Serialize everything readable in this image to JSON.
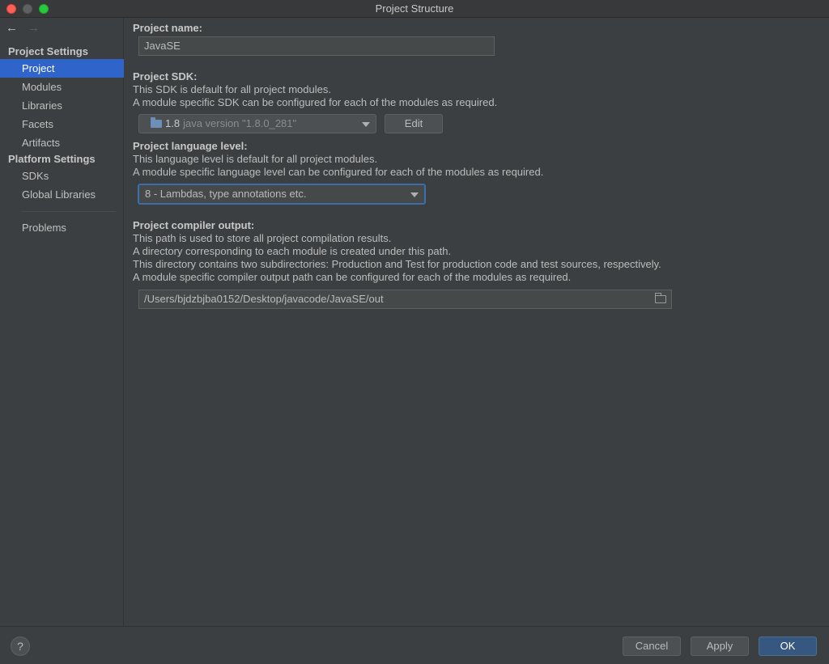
{
  "window": {
    "title": "Project Structure"
  },
  "sidebar": {
    "sections": [
      {
        "heading": "Project Settings",
        "items": [
          "Project",
          "Modules",
          "Libraries",
          "Facets",
          "Artifacts"
        ]
      },
      {
        "heading": "Platform Settings",
        "items": [
          "SDKs",
          "Global Libraries"
        ]
      }
    ],
    "extra": [
      "Problems"
    ],
    "selected": "Project"
  },
  "project_name": {
    "label": "Project name:",
    "value": "JavaSE"
  },
  "project_sdk": {
    "label": "Project SDK:",
    "desc1": "This SDK is default for all project modules.",
    "desc2": "A module specific SDK can be configured for each of the modules as required.",
    "sdk_name": "1.8",
    "sdk_version": "java version \"1.8.0_281\"",
    "edit_label": "Edit"
  },
  "language_level": {
    "label": "Project language level:",
    "desc1": "This language level is default for all project modules.",
    "desc2": "A module specific language level can be configured for each of the modules as required.",
    "value": "8 - Lambdas, type annotations etc."
  },
  "compiler_output": {
    "label": "Project compiler output:",
    "desc1": "This path is used to store all project compilation results.",
    "desc2": "A directory corresponding to each module is created under this path.",
    "desc3": "This directory contains two subdirectories: Production and Test for production code and test sources, respectively.",
    "desc4": "A module specific compiler output path can be configured for each of the modules as required.",
    "value": "/Users/bjdzbjba0152/Desktop/javacode/JavaSE/out"
  },
  "footer": {
    "help_label": "?",
    "cancel_label": "Cancel",
    "apply_label": "Apply",
    "ok_label": "OK"
  },
  "colors": {
    "background": "#3c3f41",
    "selection": "#2f65ca",
    "primary_button": "#365880",
    "focus_border": "#3d6ea8"
  },
  "icons": {
    "back": "arrow-left-icon",
    "forward": "arrow-right-icon",
    "sdk": "folder-icon",
    "browse": "folder-open-icon",
    "help": "help-icon"
  }
}
